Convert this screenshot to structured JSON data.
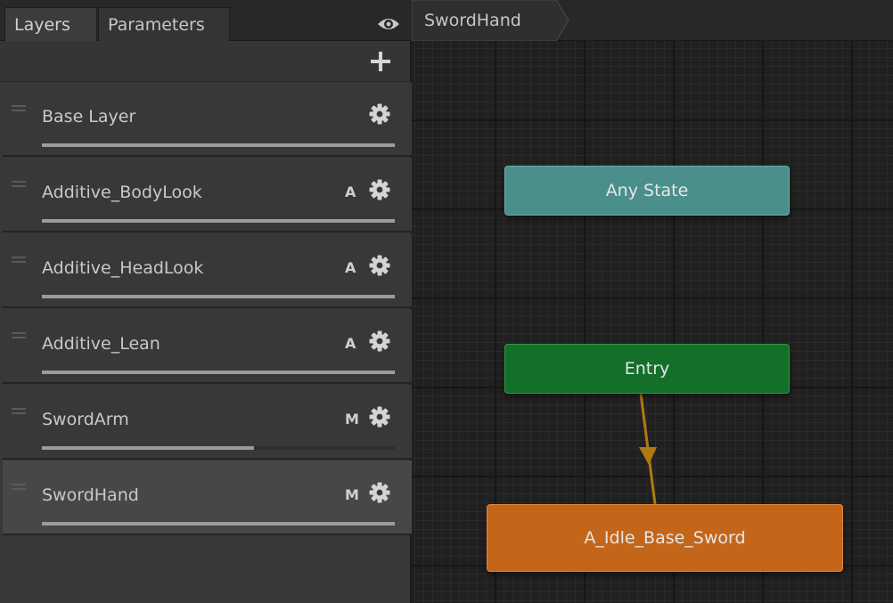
{
  "tabs": {
    "layers_label": "Layers",
    "parameters_label": "Parameters"
  },
  "layers": [
    {
      "name": "Base Layer",
      "badge": "",
      "weight": 1.0,
      "selected": false
    },
    {
      "name": "Additive_BodyLook",
      "badge": "A",
      "weight": 1.0,
      "selected": false
    },
    {
      "name": "Additive_HeadLook",
      "badge": "A",
      "weight": 1.0,
      "selected": false
    },
    {
      "name": "Additive_Lean",
      "badge": "A",
      "weight": 1.0,
      "selected": false
    },
    {
      "name": "SwordArm",
      "badge": "M",
      "weight": 0.6,
      "selected": false
    },
    {
      "name": "SwordHand",
      "badge": "M",
      "weight": 1.0,
      "selected": true
    }
  ],
  "breadcrumb": {
    "current": "SwordHand"
  },
  "graph": {
    "any_state_label": "Any State",
    "entry_label": "Entry",
    "default_state_label": "A_Idle_Base_Sword"
  },
  "colors": {
    "any_state": "#4a8f89",
    "entry": "#146f28",
    "default_state": "#c4661a",
    "transition": "#b07a10",
    "selected_layer_bg": "#474747"
  },
  "icons": {
    "visibility": "eye-icon",
    "add_layer": "plus-icon",
    "layer_settings": "gear-icon",
    "layer_reorder": "drag-handle-icon"
  }
}
